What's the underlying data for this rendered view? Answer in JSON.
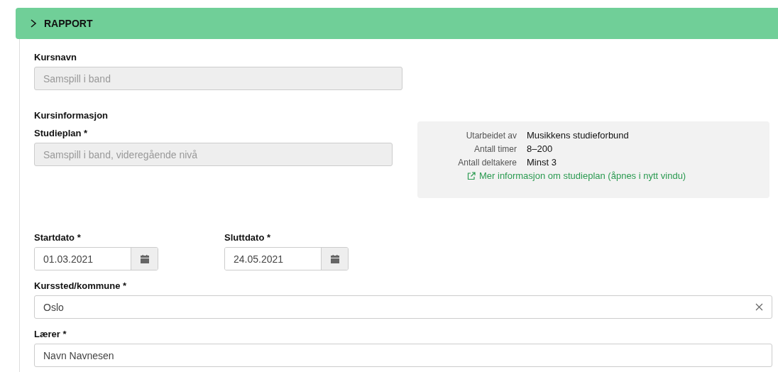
{
  "panel": {
    "title": "RAPPORT",
    "expanded": false
  },
  "course_name": {
    "label": "Kursnavn",
    "value": "Samspill i band",
    "disabled": true
  },
  "section_heading": "Kursinformasjon",
  "study_plan": {
    "label": "Studieplan *",
    "value": "Samspill i band, videregående nivå",
    "disabled": true,
    "info": {
      "rows": [
        {
          "label": "Utarbeidet av",
          "value": "Musikkens studieforbund"
        },
        {
          "label": "Antall timer",
          "value": "8–200"
        },
        {
          "label": "Antall deltakere",
          "value": "Minst 3"
        }
      ],
      "link": "Mer informasjon om studieplan (åpnes i nytt vindu)"
    }
  },
  "dates": [
    {
      "label": "Startdato *",
      "value": "01.03.2021"
    },
    {
      "label": "Sluttdato *",
      "value": "24.05.2021"
    }
  ],
  "location": {
    "label": "Kurssted/kommune *",
    "value": "Oslo",
    "clearable": true
  },
  "teacher": {
    "label": "Lærer *",
    "value": "Navn Navnesen",
    "disabled": false
  }
}
